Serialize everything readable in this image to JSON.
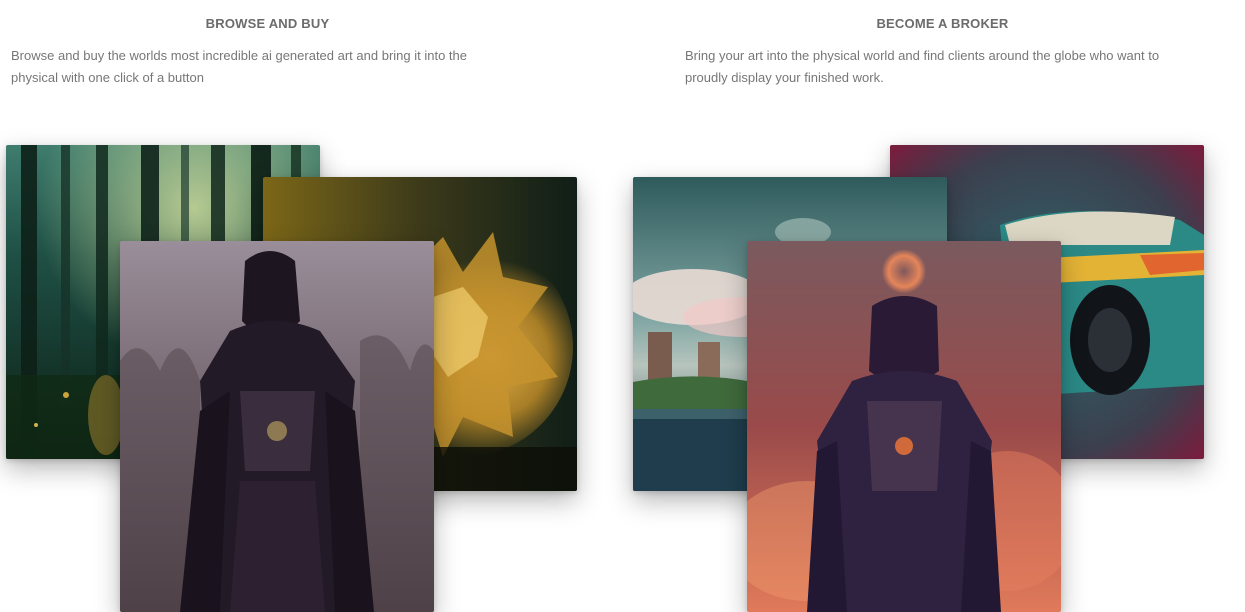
{
  "browse": {
    "title": "BROWSE AND BUY",
    "description": "Browse and buy the worlds most incredible ai generated art and bring it into the physical with one click of a button"
  },
  "broker": {
    "title": "BECOME A BROKER",
    "description": "Bring your art into the physical world and find clients around the globe who want to proudly display your finished work."
  },
  "artworks": [
    {
      "name": "forest-artwork"
    },
    {
      "name": "golden-creature-artwork"
    },
    {
      "name": "dark-armored-figure-artwork"
    },
    {
      "name": "coastal-landscape-artwork"
    },
    {
      "name": "vintage-car-artwork"
    },
    {
      "name": "smoke-armored-figure-artwork"
    }
  ]
}
